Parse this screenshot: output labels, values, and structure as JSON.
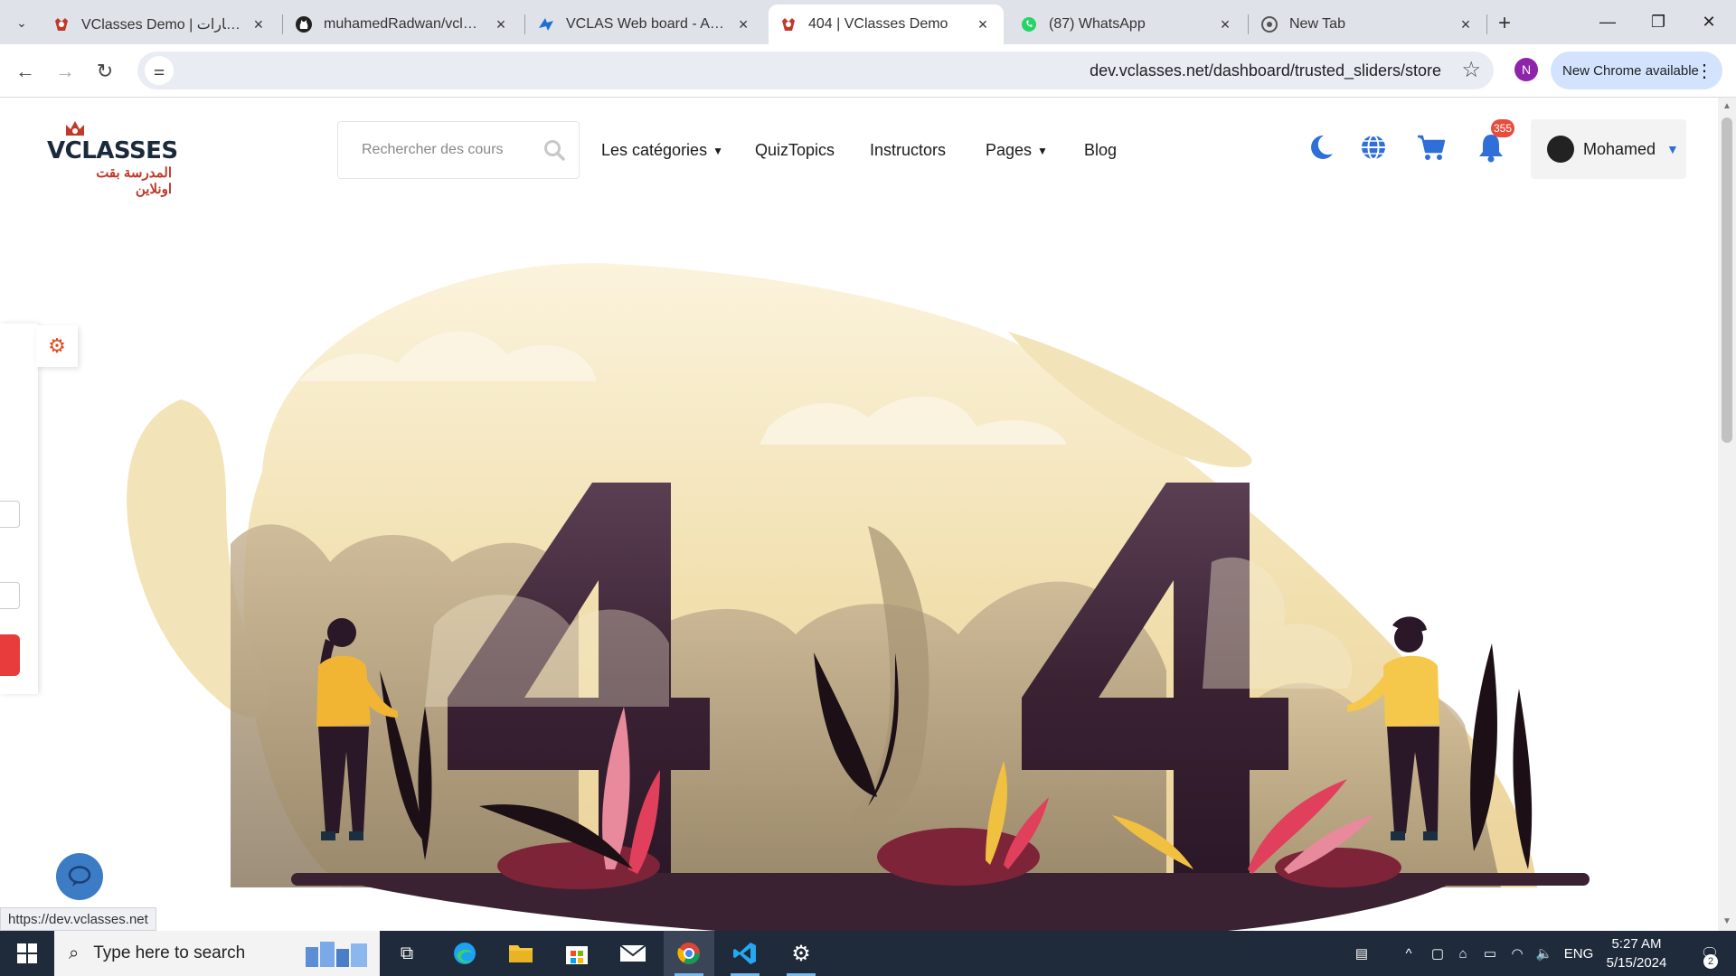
{
  "browser": {
    "tabs": [
      {
        "title": "VClasses Demo | الأختبارات",
        "icon": "vclasses-favicon"
      },
      {
        "title": "muhamedRadwan/vclasses",
        "icon": "github-icon"
      },
      {
        "title": "VCLAS Web board - Agile B",
        "icon": "azure-devops-icon"
      },
      {
        "title": "404 | VClasses Demo",
        "icon": "vclasses-favicon"
      },
      {
        "title": "(87) WhatsApp",
        "icon": "whatsapp-icon"
      },
      {
        "title": "New Tab",
        "icon": "chrome-icon"
      }
    ],
    "active_tab": 3,
    "url": "dev.vclasses.net/dashboard/trusted_sliders/store",
    "profile_initial": "N",
    "update_chip": "New Chrome available",
    "status_url": "https://dev.vclasses.net"
  },
  "site": {
    "logo_text": "VCLASSES",
    "logo_text_ar": "المدرسة بقت اونلاين",
    "search_placeholder": "Rechercher des cours",
    "menu": [
      "Les catégories",
      "QuizTopics",
      "Instructors",
      "Pages",
      "Blog"
    ],
    "notification_count": "355",
    "user_name": "Mohamed"
  },
  "error": {
    "code": "404",
    "code_digit_left": "4",
    "code_digit_right": "4"
  },
  "colors": {
    "accent": "#2e6fd8",
    "badge": "#e74c3c",
    "digit": "#3a2233",
    "sand": "#f3e5c0",
    "gear": "#e04a1b"
  },
  "taskbar": {
    "search_placeholder": "Type here to search",
    "language": "ENG",
    "time": "5:27 AM",
    "date": "5/15/2024",
    "notification_count": "2"
  }
}
